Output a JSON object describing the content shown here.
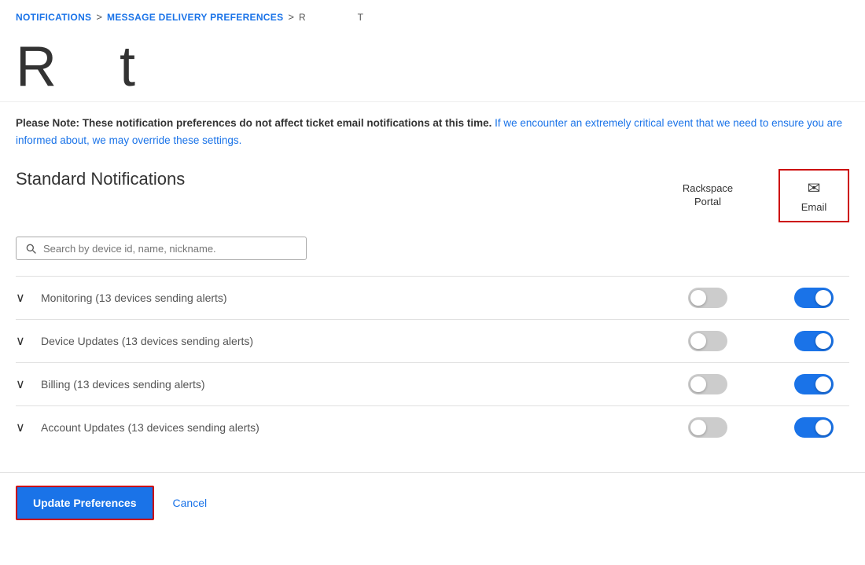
{
  "breadcrumb": {
    "items": [
      {
        "label": "NOTIFICATIONS",
        "type": "link"
      },
      {
        "sep": ">"
      },
      {
        "label": "MESSAGE DELIVERY PREFERENCES",
        "type": "link"
      },
      {
        "sep": ">"
      },
      {
        "label": "R",
        "type": "current"
      }
    ],
    "extra": "T"
  },
  "page_title": {
    "r": "R",
    "t": "t"
  },
  "notice": {
    "bold_text": "Please Note: These notification preferences do not affect ticket email notifications at this time.",
    "body_text": " If we encounter an extremely critical event that we need to ensure you are informed about, we may override these settings."
  },
  "columns": {
    "rackspace_portal": "Rackspace\nPortal",
    "email": "Email",
    "email_icon": "✉"
  },
  "section": {
    "title": "Standard Notifications"
  },
  "search": {
    "placeholder": "Search by device id, name, nickname."
  },
  "notifications": [
    {
      "id": "monitoring",
      "label": "Monitoring (13 devices sending alerts)",
      "portal_on": false,
      "email_on": true
    },
    {
      "id": "device-updates",
      "label": "Device Updates (13 devices sending alerts)",
      "portal_on": false,
      "email_on": true
    },
    {
      "id": "billing",
      "label": "Billing (13 devices sending alerts)",
      "portal_on": false,
      "email_on": true
    },
    {
      "id": "account-updates",
      "label": "Account Updates (13 devices sending alerts)",
      "portal_on": false,
      "email_on": true
    }
  ],
  "buttons": {
    "update": "Update Preferences",
    "cancel": "Cancel"
  }
}
